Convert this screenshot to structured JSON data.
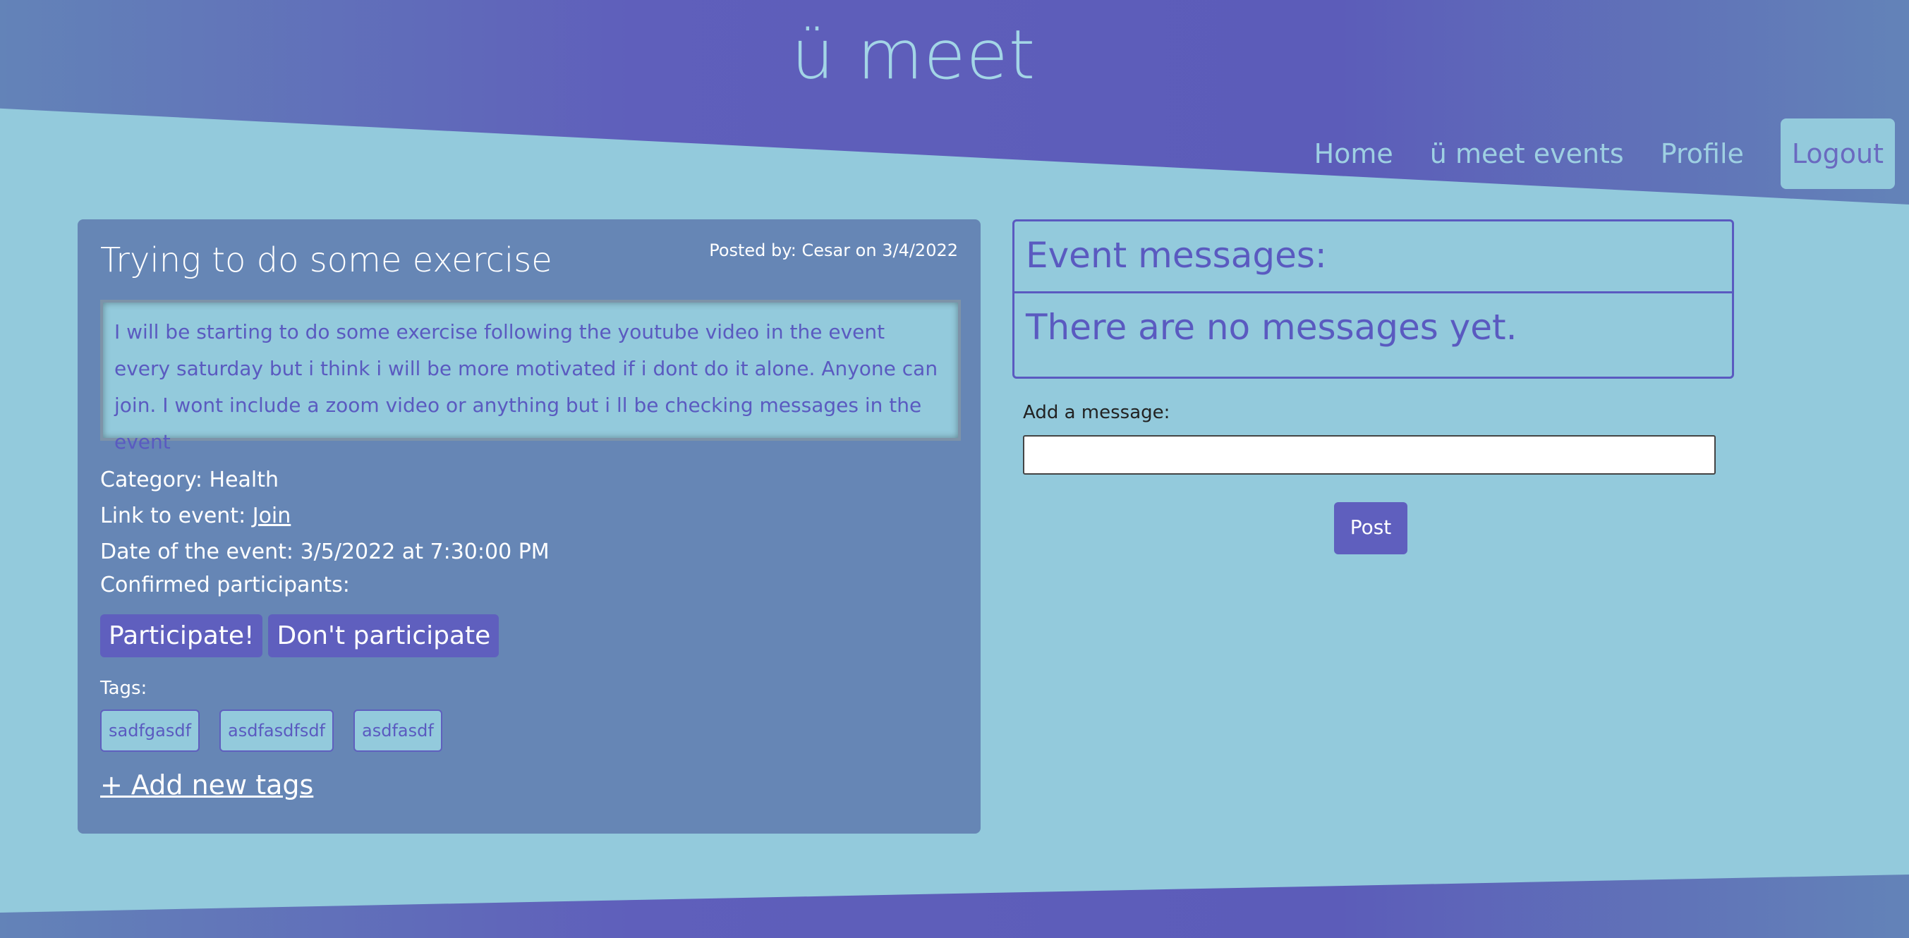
{
  "site": {
    "title": "ü meet"
  },
  "nav": {
    "items": [
      "Home",
      "ü meet events",
      "Profile"
    ],
    "logout": "Logout"
  },
  "event": {
    "title": "Trying to do some exercise",
    "posted_by": "Posted by: Cesar on 3/4/2022",
    "description": "I will be starting to do some exercise following the youtube video in the event every saturday but i think i will be more motivated if i dont do it alone. Anyone can join. I wont include a zoom video or anything but i ll be checking messages in the event",
    "category_label": "Category:",
    "category": "Health",
    "link_label": "Link to event:",
    "link_text": "Join",
    "date_label": "Date of the event:",
    "date": "3/5/2022 at 7:30:00 PM",
    "participants_label": "Confirmed participants:",
    "participate_button": "Participate!",
    "dont_participate_button": "Don't participate",
    "tags_label": "Tags:",
    "tags": [
      "sadfgasdf",
      "asdfasdfsdf",
      "asdfasdf"
    ],
    "add_tags": "+ Add new tags"
  },
  "messages": {
    "header": "Event messages:",
    "empty": "There are no messages yet.",
    "add_label": "Add a message:",
    "post_button": "Post"
  },
  "colors": {
    "background": "#93cadc",
    "header": "#5f5fbb",
    "card": "#6686b5",
    "accent": "#5f5fbe"
  }
}
